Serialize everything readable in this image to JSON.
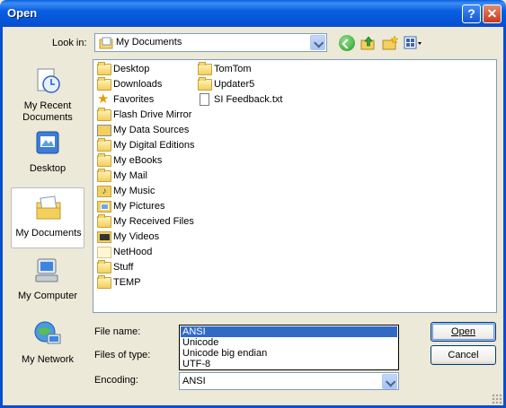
{
  "window": {
    "title": "Open",
    "help_glyph": "?",
    "close_glyph": "✕"
  },
  "lookin": {
    "label": "Look in:",
    "value": "My Documents"
  },
  "places": [
    {
      "name": "My Recent Documents",
      "line1": "My Recent",
      "line2": "Documents",
      "icon": "recent-documents-icon"
    },
    {
      "name": "Desktop",
      "line1": "Desktop",
      "line2": "",
      "icon": "desktop-icon"
    },
    {
      "name": "My Documents",
      "line1": "My Documents",
      "line2": "",
      "icon": "my-documents-icon",
      "selected": true
    },
    {
      "name": "My Computer",
      "line1": "My Computer",
      "line2": "",
      "icon": "my-computer-icon"
    },
    {
      "name": "My Network",
      "line1": "My Network",
      "line2": "",
      "icon": "my-network-icon"
    }
  ],
  "files": [
    {
      "name": "Desktop",
      "type": "folder"
    },
    {
      "name": "Downloads",
      "type": "folder"
    },
    {
      "name": "Favorites",
      "type": "favorites"
    },
    {
      "name": "Flash Drive Mirror",
      "type": "folder"
    },
    {
      "name": "My Data Sources",
      "type": "special"
    },
    {
      "name": "My Digital Editions",
      "type": "folder"
    },
    {
      "name": "My eBooks",
      "type": "folder"
    },
    {
      "name": "My Mail",
      "type": "folder"
    },
    {
      "name": "My Music",
      "type": "special"
    },
    {
      "name": "My Pictures",
      "type": "special"
    },
    {
      "name": "My Received Files",
      "type": "folder"
    },
    {
      "name": "My Videos",
      "type": "special"
    },
    {
      "name": "NetHood",
      "type": "folder-light"
    },
    {
      "name": "Stuff",
      "type": "folder"
    },
    {
      "name": "TEMP",
      "type": "folder"
    },
    {
      "name": "TomTom",
      "type": "folder"
    },
    {
      "name": "Updater5",
      "type": "folder"
    },
    {
      "name": "SI Feedback.txt",
      "type": "text"
    }
  ],
  "form": {
    "filename_label": "File name:",
    "filetype_label": "Files of type:",
    "encoding_label": "Encoding:",
    "encoding_value": "ANSI",
    "encoding_options": [
      "ANSI",
      "Unicode",
      "Unicode big endian",
      "UTF-8"
    ],
    "encoding_selected_index": 0
  },
  "buttons": {
    "open": "Open",
    "cancel": "Cancel"
  }
}
